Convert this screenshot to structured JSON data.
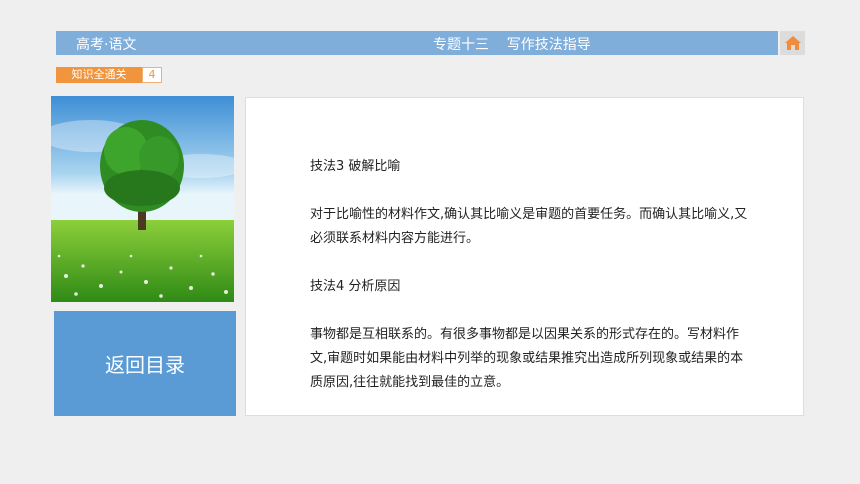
{
  "header": {
    "left_title": "高考·语文",
    "right_title": "专题十三    写作技法指导"
  },
  "tag": {
    "label": "知识全通关",
    "number": "4"
  },
  "photo": {
    "description_icon": "tree-meadow-image"
  },
  "nav": {
    "back_label": "返回目录",
    "home_icon": "home-icon"
  },
  "content": {
    "heading1": "技法3 破解比喻",
    "paragraph1": "对于比喻性的材料作文,确认其比喻义是审题的首要任务。而确认其比喻义,又必须联系材料内容方能进行。",
    "heading2": "技法4 分析原因",
    "paragraph2": "事物都是互相联系的。有很多事物都是以因果关系的形式存在的。写材料作文,审题时如果能由材料中列举的现象或结果推究出造成所列现象或结果的本质原因,往往就能找到最佳的立意。"
  },
  "colors": {
    "header_bg": "#7faedb",
    "tag_orange": "#f0943d",
    "back_button_bg": "#5b9bd5",
    "home_icon": "#f08c3c"
  }
}
